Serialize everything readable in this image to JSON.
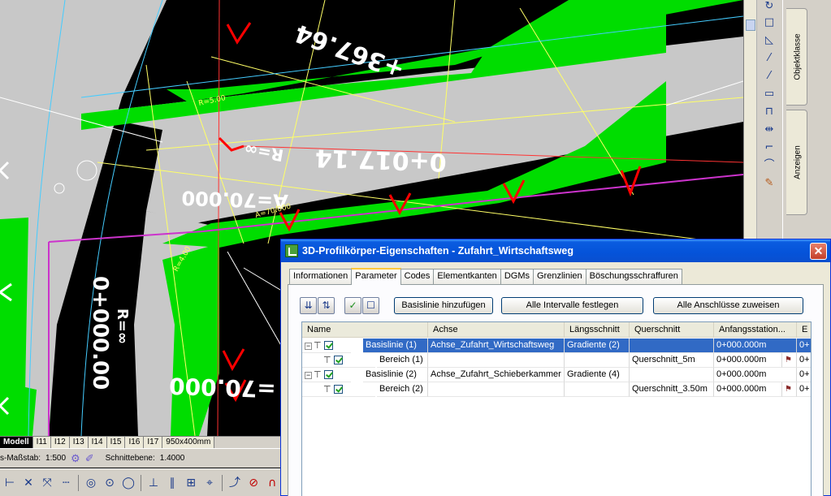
{
  "colors": {
    "road_fill": "#c8c8c8",
    "embankment_green": "#00dd00",
    "marker_red": "#ff0000",
    "text_white": "#ffffff",
    "magenta": "#cc33cc",
    "titlebar_blue": "#0553d9",
    "selection_blue": "#316ac5"
  },
  "drawing": {
    "station_labels": [
      "+367.64",
      "0+017.14",
      "A=70.000",
      "0+000.00",
      "=70.000",
      "R=∞",
      "R=∞",
      "R=5.00",
      "R=4.00",
      "A=70.000"
    ]
  },
  "layout_tabs": {
    "items": [
      "Modell",
      "I11",
      "I12",
      "I13",
      "I14",
      "I15",
      "I16",
      "I17",
      "950x400mm"
    ],
    "active": "Modell"
  },
  "status_bar": {
    "scale_label": "s-Maßstab:",
    "scale_value": "1:500",
    "section_label": "Schnittebene:",
    "section_value": "1.4000"
  },
  "side_tabs": [
    "Objektklasse",
    "Anzeigen"
  ],
  "dialog": {
    "title": "3D-Profilkörper-Eigenschaften - Zufahrt_Wirtschaftsweg",
    "close_label": "✕",
    "tabs": [
      "Informationen",
      "Parameter",
      "Codes",
      "Elementkanten",
      "DGMs",
      "Grenzlinien",
      "Böschungsschraffuren"
    ],
    "active_tab": "Parameter",
    "buttons": {
      "add_baseline": "Basislinie hinzufügen",
      "set_all_intervals": "Alle Intervalle festlegen",
      "assign_all_connections": "Alle Anschlüsse zuweisen"
    },
    "grid": {
      "columns": [
        "Name",
        "Achse",
        "Längsschnitt",
        "Querschnitt",
        "Anfangsstation...",
        "E"
      ],
      "rows": [
        {
          "name": "Basislinie (1)",
          "achse": "Achse_Zufahrt_Wirtschaftsweg",
          "laengsschnitt": "Gradiente (2)",
          "querschnitt": "",
          "anfang": "0+000.000m",
          "e": "0+",
          "selected": true,
          "level": 0
        },
        {
          "name": "Bereich (1)",
          "achse": "",
          "laengsschnitt": "",
          "querschnitt": "Querschnitt_5m",
          "anfang": "0+000.000m",
          "e": "0+",
          "selected": false,
          "level": 1
        },
        {
          "name": "Basislinie (2)",
          "achse": "Achse_Zufahrt_Schieberkammer",
          "laengsschnitt": "Gradiente (4)",
          "querschnitt": "",
          "anfang": "0+000.000m",
          "e": "0+",
          "selected": false,
          "level": 0
        },
        {
          "name": "Bereich (2)",
          "achse": "",
          "laengsschnitt": "",
          "querschnitt": "Querschnitt_3.50m",
          "anfang": "0+000.000m",
          "e": "0+",
          "selected": false,
          "level": 1
        }
      ]
    }
  }
}
